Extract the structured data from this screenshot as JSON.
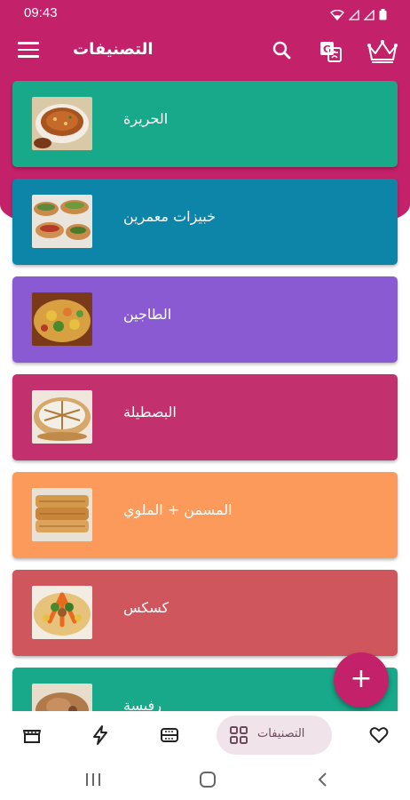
{
  "status_bar": {
    "time": "09:43"
  },
  "app_bar": {
    "title": "التصنيفات",
    "menu_icon": "hamburger-icon",
    "search_icon": "search-icon",
    "translate_icon": "translate-icon",
    "premium_icon": "crown-icon"
  },
  "categories": [
    {
      "label": "الحريرة",
      "color": "#17a989"
    },
    {
      "label": "خبيزات معمرين",
      "color": "#0d85a9"
    },
    {
      "label": "الطاجين",
      "color": "#8a5ad2"
    },
    {
      "label": "البصطيلة",
      "color": "#c3306e"
    },
    {
      "label": "المسمن + الملوي",
      "color": "#fb9a5b"
    },
    {
      "label": "كسكس",
      "color": "#d0565e"
    },
    {
      "label": "رفيسة",
      "color": "#17a989"
    }
  ],
  "fab": {
    "icon": "+"
  },
  "bottom_nav": {
    "active_label": "التصنيفات",
    "items": [
      "store-icon",
      "bolt-icon",
      "tray-icon",
      "grid-icon",
      "heart-icon"
    ]
  },
  "colors": {
    "primary": "#c3216a",
    "nav_pill": "#f0e3ea"
  }
}
